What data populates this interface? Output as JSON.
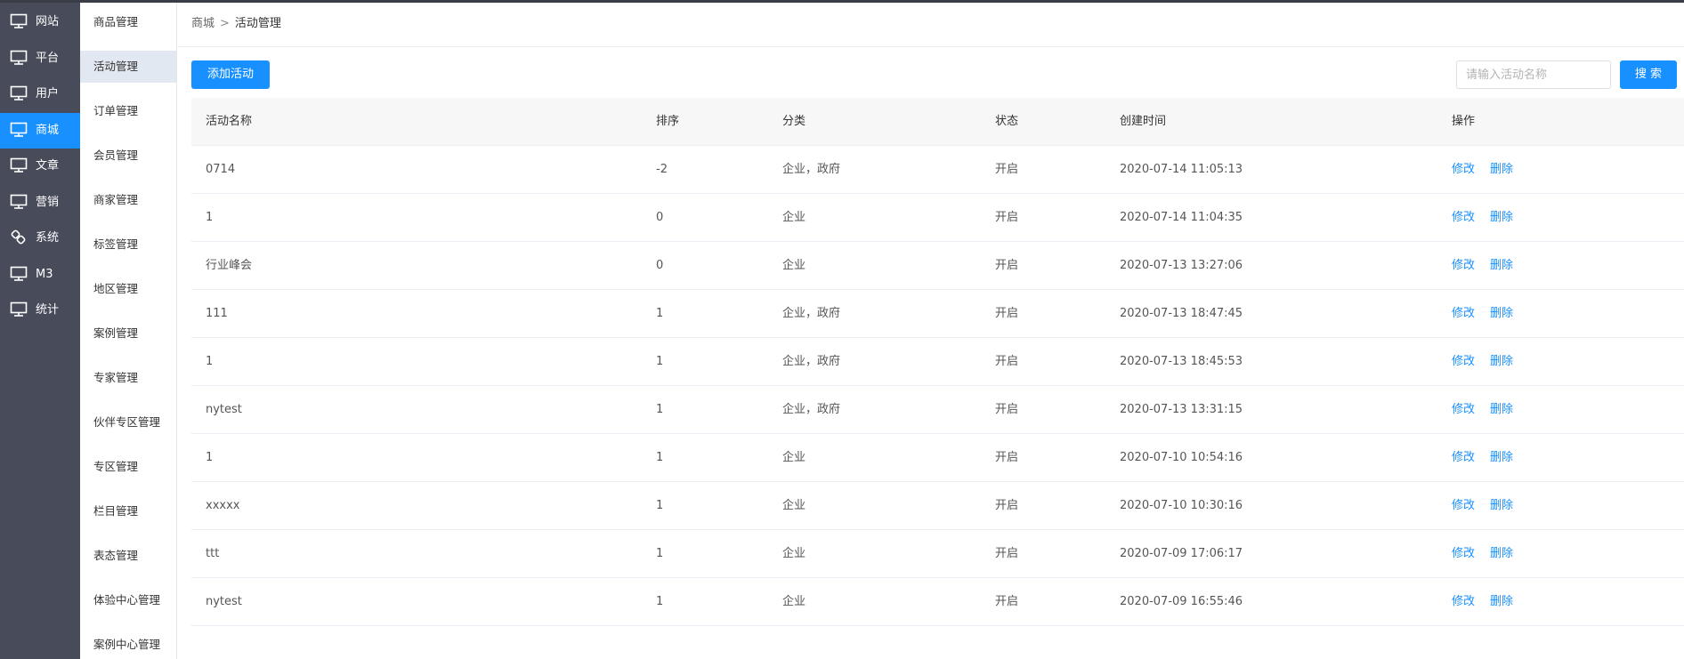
{
  "nav_primary": [
    {
      "label": "网站",
      "icon": "monitor-icon",
      "active": false
    },
    {
      "label": "平台",
      "icon": "monitor-icon",
      "active": false
    },
    {
      "label": "用户",
      "icon": "monitor-icon",
      "active": false
    },
    {
      "label": "商城",
      "icon": "monitor-icon",
      "active": true
    },
    {
      "label": "文章",
      "icon": "monitor-icon",
      "active": false
    },
    {
      "label": "营销",
      "icon": "monitor-icon",
      "active": false
    },
    {
      "label": "系统",
      "icon": "link-icon",
      "active": false
    },
    {
      "label": "M3",
      "icon": "monitor-icon",
      "active": false
    },
    {
      "label": "统计",
      "icon": "monitor-icon",
      "active": false
    }
  ],
  "nav_secondary": [
    {
      "label": "商品管理",
      "active": false
    },
    {
      "label": "活动管理",
      "active": true
    },
    {
      "label": "订单管理",
      "active": false
    },
    {
      "label": "会员管理",
      "active": false
    },
    {
      "label": "商家管理",
      "active": false
    },
    {
      "label": "标签管理",
      "active": false
    },
    {
      "label": "地区管理",
      "active": false
    },
    {
      "label": "案例管理",
      "active": false
    },
    {
      "label": "专家管理",
      "active": false
    },
    {
      "label": "伙伴专区管理",
      "active": false
    },
    {
      "label": "专区管理",
      "active": false
    },
    {
      "label": "栏目管理",
      "active": false
    },
    {
      "label": "表态管理",
      "active": false
    },
    {
      "label": "体验中心管理",
      "active": false
    },
    {
      "label": "案例中心管理",
      "active": false
    }
  ],
  "breadcrumb": {
    "root": "商城",
    "separator": ">",
    "current": "活动管理"
  },
  "toolbar": {
    "add_label": "添加活动",
    "search_placeholder": "请输入活动名称",
    "search_label": "搜 索"
  },
  "table": {
    "headers": {
      "name": "活动名称",
      "sort": "排序",
      "category": "分类",
      "status": "状态",
      "created": "创建时间",
      "ops": "操作"
    },
    "edit_label": "修改",
    "delete_label": "删除",
    "rows": [
      {
        "name": "0714",
        "sort": "-2",
        "category": "企业，政府",
        "status": "开启",
        "created": "2020-07-14 11:05:13"
      },
      {
        "name": "1",
        "sort": "0",
        "category": "企业",
        "status": "开启",
        "created": "2020-07-14 11:04:35"
      },
      {
        "name": "行业峰会",
        "sort": "0",
        "category": "企业",
        "status": "开启",
        "created": "2020-07-13 13:27:06"
      },
      {
        "name": "111",
        "sort": "1",
        "category": "企业，政府",
        "status": "开启",
        "created": "2020-07-13 18:47:45"
      },
      {
        "name": "1",
        "sort": "1",
        "category": "企业，政府",
        "status": "开启",
        "created": "2020-07-13 18:45:53"
      },
      {
        "name": "nytest",
        "sort": "1",
        "category": "企业，政府",
        "status": "开启",
        "created": "2020-07-13 13:31:15"
      },
      {
        "name": "1",
        "sort": "1",
        "category": "企业",
        "status": "开启",
        "created": "2020-07-10 10:54:16"
      },
      {
        "name": "xxxxx",
        "sort": "1",
        "category": "企业",
        "status": "开启",
        "created": "2020-07-10 10:30:16"
      },
      {
        "name": "ttt",
        "sort": "1",
        "category": "企业",
        "status": "开启",
        "created": "2020-07-09 17:06:17"
      },
      {
        "name": "nytest",
        "sort": "1",
        "category": "企业",
        "status": "开启",
        "created": "2020-07-09 16:55:46"
      }
    ]
  },
  "colors": {
    "accent": "#1890ff",
    "sidebar_bg": "#484c5a",
    "submenu_active_bg": "#e2e8f1"
  }
}
